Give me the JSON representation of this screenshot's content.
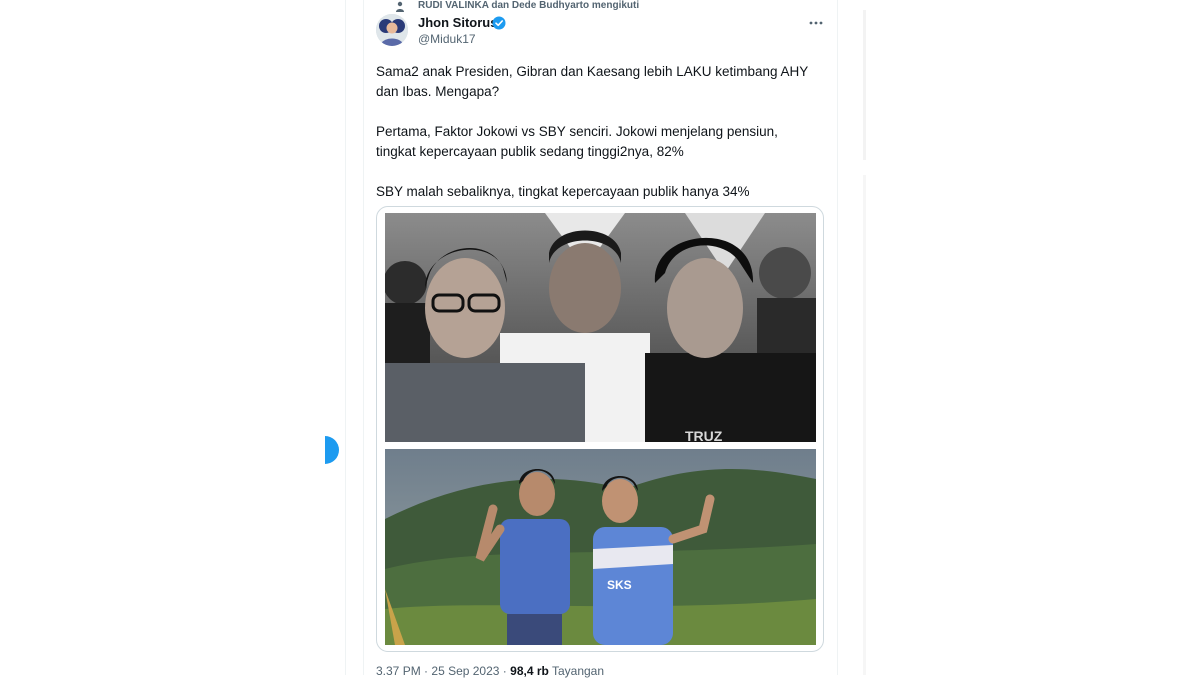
{
  "social_context": {
    "text": "RUDI VALINKA dan Dede Budhyarto mengikuti",
    "icon": "person-icon"
  },
  "author": {
    "display_name": "Jhon Sitorus",
    "handle": "@Miduk17",
    "verified": true,
    "verified_color": "#1d9bf0"
  },
  "tweet": {
    "paragraphs": [
      "Sama2 anak Presiden, Gibran dan Kaesang lebih LAKU ketimbang AHY dan Ibas. Mengapa?",
      "Pertama, Faktor Jokowi vs SBY senciri. Jokowi menjelang pensiun, tingkat kepercayaan publik sedang tinggi2nya, 82%",
      "SBY malah sebaliknya, tingkat kepercayaan publik hanya 34%"
    ]
  },
  "media": {
    "top_photo": "black-and-white photo of three men",
    "bottom_photo": "two men in sports shirts outdoors with mountains"
  },
  "meta": {
    "time": "3.37 PM",
    "date": "25 Sep 2023",
    "separator": "·",
    "views": "98,4 rb",
    "views_label": "Tayangan"
  },
  "colors": {
    "accent": "#1d9bf0",
    "text_primary": "#0f1419",
    "text_secondary": "#536471",
    "border": "#cfd9de"
  }
}
